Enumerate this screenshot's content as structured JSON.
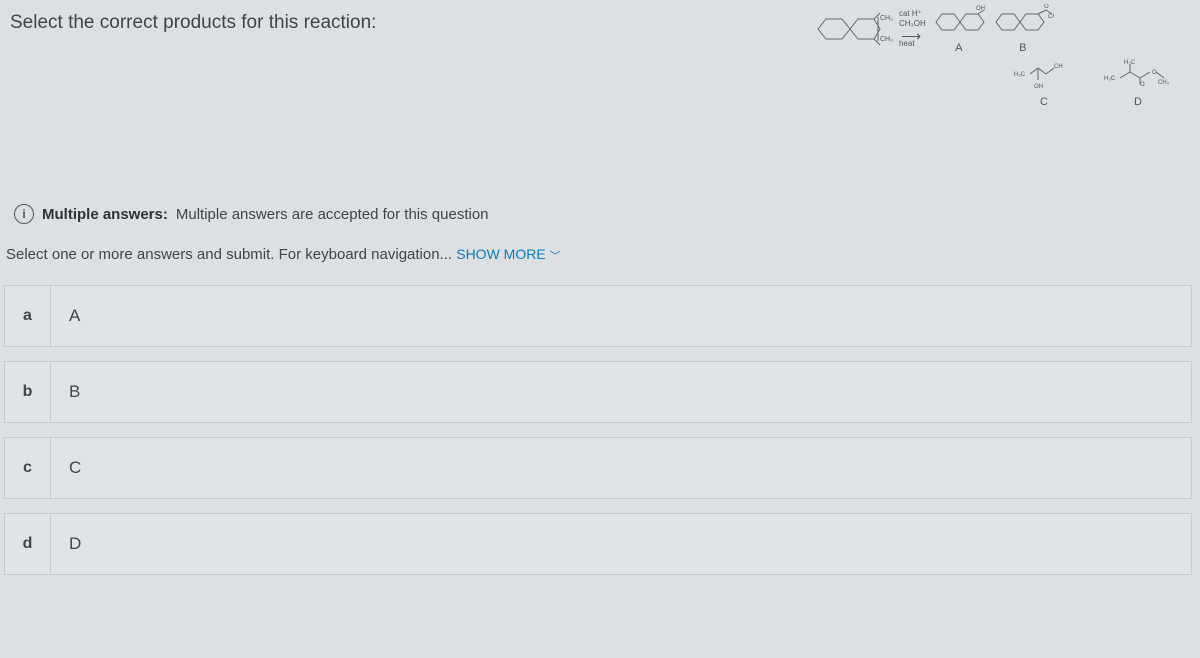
{
  "question": "Select the correct products for this reaction:",
  "reaction": {
    "reagent_line1": "cat H⁺",
    "reagent_line2": "CH₃OH",
    "reagent_line3": "heat",
    "start_labels": {
      "top": "CH₃",
      "bottom": "CH₃"
    }
  },
  "products": {
    "A": {
      "label": "A",
      "sub": "OH"
    },
    "B": {
      "label": "B",
      "sub": "CH₃"
    },
    "C": {
      "label": "C",
      "sub1": "H₃C",
      "sub2": "CH",
      "sub3": "OH"
    },
    "D": {
      "label": "D",
      "sub1": "H₃C",
      "sub2": "CH₃",
      "subtop": "H₃C"
    }
  },
  "info": {
    "bold": "Multiple answers:",
    "text": "Multiple answers are accepted for this question"
  },
  "instructions": {
    "text": "Select one or more answers and submit. For keyboard navigation... ",
    "show_more": "SHOW MORE"
  },
  "options": [
    {
      "key": "a",
      "label": "A"
    },
    {
      "key": "b",
      "label": "B"
    },
    {
      "key": "c",
      "label": "C"
    },
    {
      "key": "d",
      "label": "D"
    }
  ]
}
